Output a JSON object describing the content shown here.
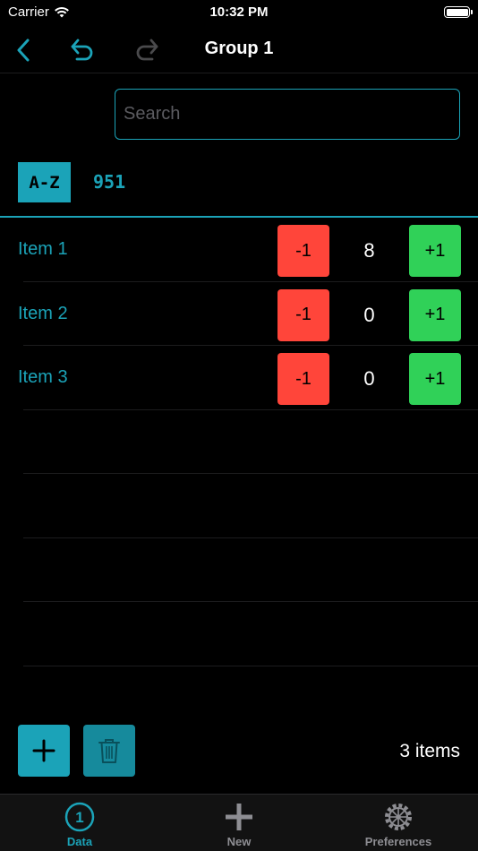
{
  "status_bar": {
    "carrier": "Carrier",
    "time": "10:32 PM"
  },
  "nav": {
    "title": "Group 1"
  },
  "search": {
    "placeholder": "Search",
    "value": ""
  },
  "toolbar": {
    "sort_label": "A-Z",
    "total": "951"
  },
  "items": [
    {
      "name": "Item 1",
      "dec_label": "-1",
      "count": "8",
      "inc_label": "+1"
    },
    {
      "name": "Item 2",
      "dec_label": "-1",
      "count": "0",
      "inc_label": "+1"
    },
    {
      "name": "Item 3",
      "dec_label": "-1",
      "count": "0",
      "inc_label": "+1"
    }
  ],
  "footer": {
    "item_count": "3 items"
  },
  "tabs": [
    {
      "label": "Data",
      "icon": "number-one-circle-icon",
      "active": true
    },
    {
      "label": "New",
      "icon": "plus-icon",
      "active": false
    },
    {
      "label": "Preferences",
      "icon": "gear-icon",
      "active": false
    }
  ],
  "colors": {
    "accent": "#1ba3b8",
    "decrement": "#ff453a",
    "increment": "#30d158",
    "background": "#000000",
    "inactive": "#8e8e93"
  }
}
